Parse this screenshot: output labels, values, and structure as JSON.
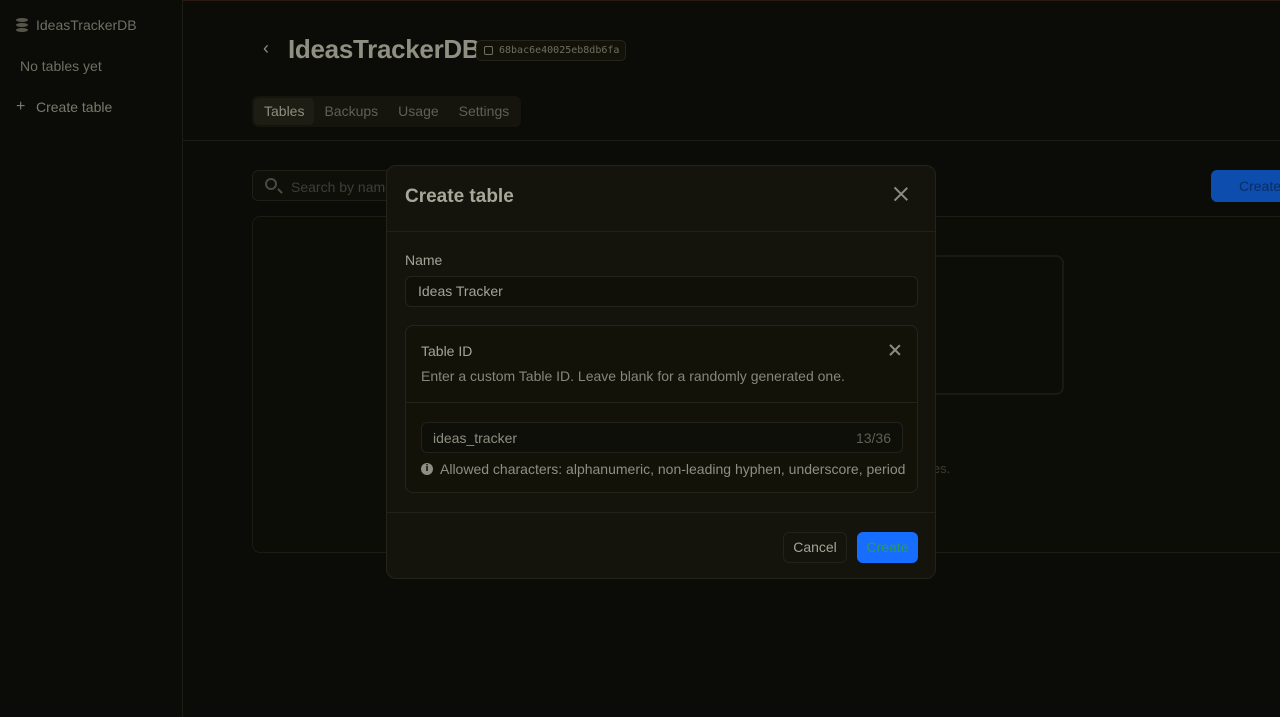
{
  "sidebar": {
    "db_name": "IdeasTrackerDB",
    "empty_label": "No tables yet",
    "create_label": "Create table"
  },
  "header": {
    "title": "IdeasTrackerDB",
    "db_id": "68bac6e40025eb8db6fa",
    "tabs": [
      {
        "label": "Tables",
        "active": true
      },
      {
        "label": "Backups",
        "active": false
      },
      {
        "label": "Usage",
        "active": false
      },
      {
        "label": "Settings",
        "active": false
      }
    ]
  },
  "main": {
    "search_placeholder": "Search by name",
    "create_button": "Create table",
    "empty_hint": "les."
  },
  "modal": {
    "title": "Create table",
    "name_label": "Name",
    "name_value": "Ideas Tracker",
    "table_id": {
      "title": "Table ID",
      "description": "Enter a custom Table ID. Leave blank for a randomly generated one.",
      "value": "ideas_tracker",
      "counter": "13/36",
      "hint": "Allowed characters: alphanumeric, non-leading hyphen, underscore, period"
    },
    "cancel_label": "Cancel",
    "create_label": "Create"
  },
  "colors": {
    "accent": "#176dff",
    "background": "#0b0b07",
    "modal_bg": "#14140c"
  }
}
